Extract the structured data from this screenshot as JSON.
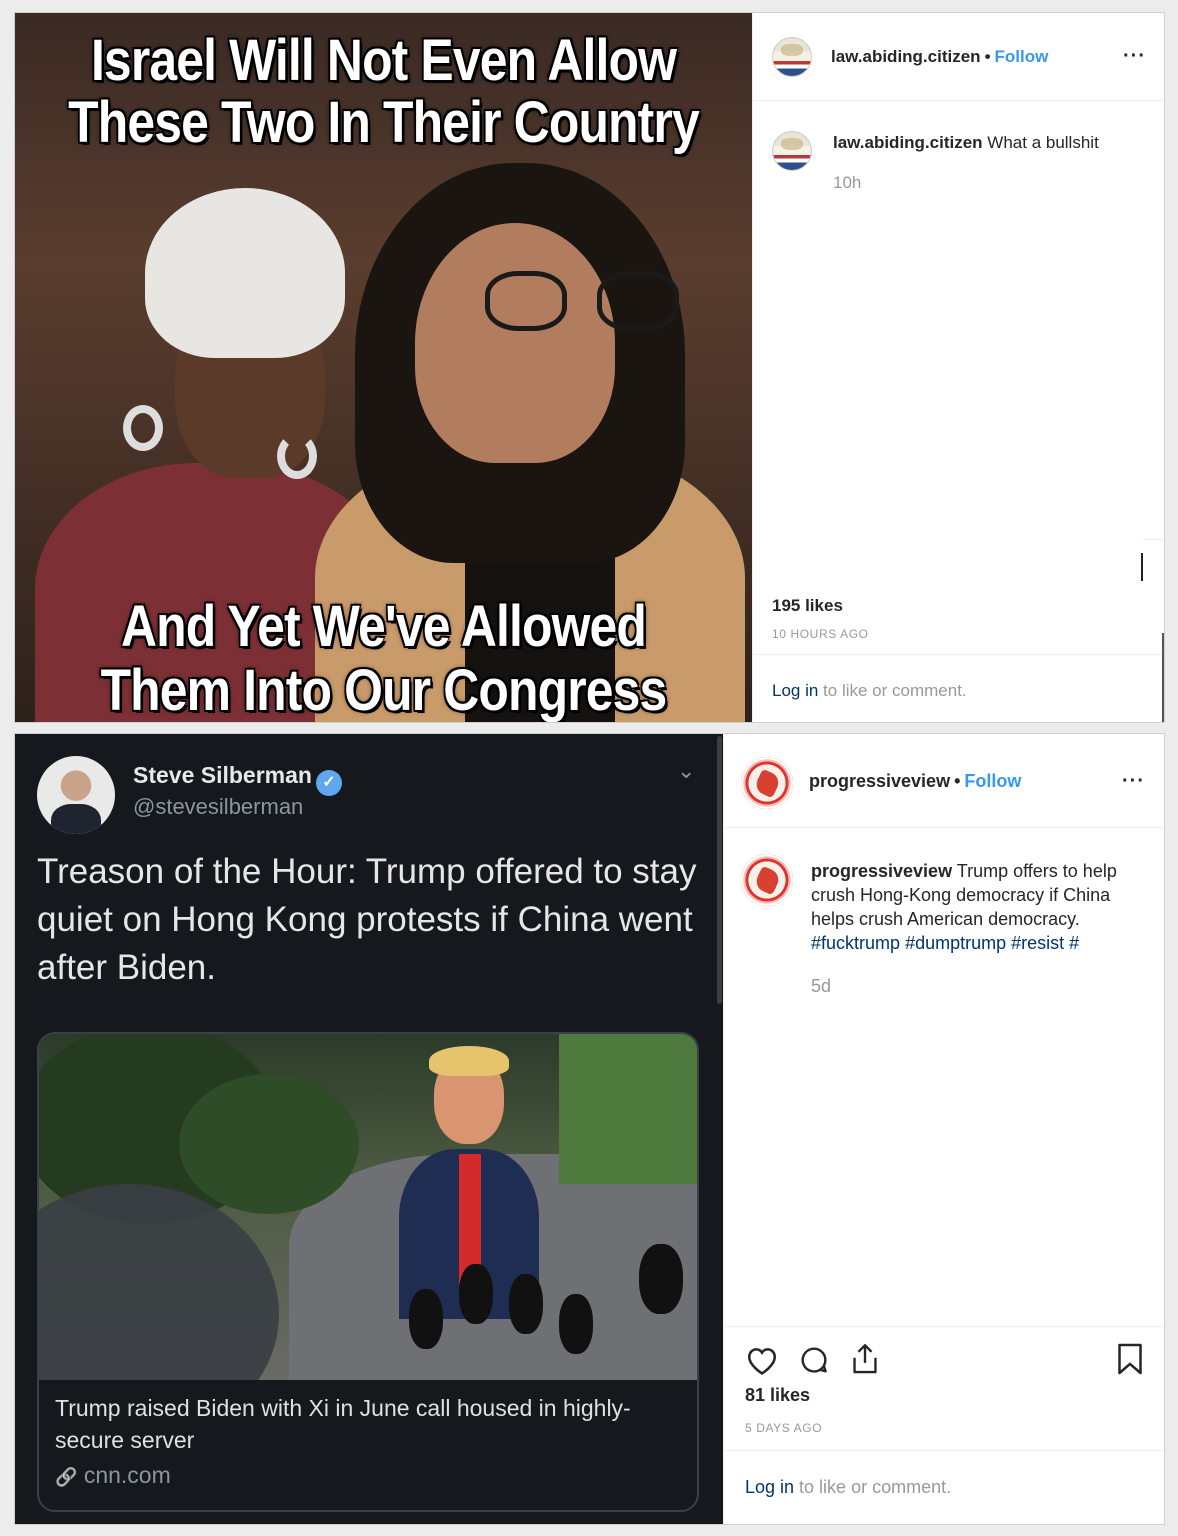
{
  "post1": {
    "meme": {
      "line1": "Israel Will Not Even Allow",
      "line2": "These Two In Their Country",
      "line3": "And Yet We've Allowed",
      "line4": "Them Into Our Congress"
    },
    "header": {
      "username": "law.abiding.citizen",
      "separator": "•",
      "follow_label": "Follow",
      "more_label": "···"
    },
    "comment": {
      "username": "law.abiding.citizen",
      "text": "What a bullshit",
      "time": "10h"
    },
    "likes": "195 likes",
    "ago": "10 HOURS AGO",
    "login": {
      "link": "Log in",
      "rest": " to like or comment."
    }
  },
  "post2": {
    "tweet": {
      "name": "Steve Silberman",
      "verified_icon": "✓",
      "handle": "@stevesilberman",
      "chevron": "⌄",
      "text": "Treason of the Hour: Trump offered to stay quiet on Hong Kong protests if China went after Biden.",
      "card_caption": "Trump raised Biden with Xi in June call housed in highly-secure server",
      "card_link": "cnn.com",
      "link_icon": "🔗"
    },
    "header": {
      "username": "progressiveview",
      "separator": "•",
      "follow_label": "Follow",
      "more_label": "···"
    },
    "caption": {
      "username": "progressiveview",
      "text": "Trump offers to help crush Hong-Kong democracy if China helps crush American democracy.",
      "tags": [
        "#fucktrump",
        "#dumptrump",
        "#resist",
        "#"
      ],
      "time": "5d"
    },
    "icons": [
      "heart-icon",
      "comment-icon",
      "share-icon",
      "bookmark-icon"
    ],
    "likes": "81 likes",
    "ago": "5 DAYS AGO",
    "login": {
      "link": "Log in",
      "rest": " to like or comment."
    }
  },
  "colors": {
    "follow": "#3897f0",
    "hashtag": "#003569",
    "muted": "#999999",
    "text": "#262626"
  }
}
